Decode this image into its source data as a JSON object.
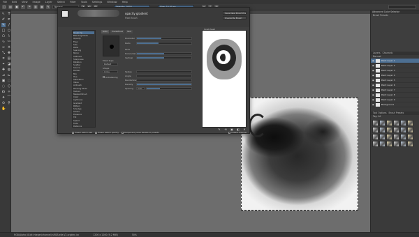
{
  "menu": [
    "File",
    "Edit",
    "View",
    "Image",
    "Layer",
    "Select",
    "Filter",
    "Tools",
    "Settings",
    "Window",
    "Help"
  ],
  "toolbar": {
    "blend_mode": "Normal",
    "preset_field": "opacity gradient",
    "opacity_slider": "Opacity: 100%",
    "size_slider": "Size: 10.00 px"
  },
  "document": {
    "tab_title": "[Not Saved] *",
    "close_glyph": "×"
  },
  "statusbar": {
    "color_info": "RGB/Alpha (8-bit integer/channel) sRGB-elle-V2-srgbtrc.icc",
    "size_info": "1200 x 1200 (9.2 MiB)",
    "zoom": "50%"
  },
  "dialog": {
    "preset_name": "opacity gradient",
    "preset_sub": "Pixel Brush",
    "buttons": {
      "save_new": "Save New Brush Preset...",
      "overwrite": "Overwrite Brush"
    },
    "options": [
      "Brush Tip",
      "Blending Mode",
      "Opacity",
      "Flow",
      "Size",
      "Ratio",
      "Spacing",
      "Mirror",
      "Softness",
      "Sharpness",
      "Rotation",
      "Scatter",
      "Source",
      "Darken",
      "Mix",
      "Hue",
      "Saturation",
      "Value",
      "Airbrush",
      "Painting Mode",
      "Texture",
      "Masked Brush",
      "Color",
      "Lightness",
      "Gradient",
      "Pattern",
      "Smudge",
      "Stroke",
      "Pressure",
      "Tilt",
      "Speed",
      "Fade",
      "Distance",
      "Time",
      "Fuzzy"
    ],
    "tabs": [
      "Auto",
      "Predefined",
      "Text"
    ],
    "params": {
      "diameter_label": "Diameter",
      "diameter_value": "10.00 px",
      "ratio_label": "Ratio",
      "ratio_value": "1.00",
      "fade_label": "Fade",
      "horizontal_label": "Horizontal",
      "horizontal_value": "0.50",
      "vertical_label": "Vertical",
      "vertical_value": "0.50",
      "mask_type_label": "Mask Type",
      "mask_type_value": "Default",
      "shape_label": "Shape",
      "shape_value": "Circle",
      "antialias_label": "Antialiasing",
      "spikes_label": "Spikes",
      "spikes_value": "2",
      "angle_label": "Angle",
      "angle_value": "0°",
      "randomness_label": "Randomness",
      "randomness_value": "0.00",
      "density_label": "Density",
      "density_value": "100.00%",
      "spacing_label": "Spacing",
      "spacing_value": "0.10",
      "auto_label": "Auto"
    },
    "scratchpad_label": "Scratchpad",
    "footer": {
      "eraser_size": "Eraser switch size",
      "eraser_opacity": "Eraser switch opacity",
      "temp_save": "Temporarily save tweaks to presets",
      "instant_preview": "Instant Preview"
    }
  },
  "dockers": {
    "advanced_color": "Advanced Color Selector",
    "overview_sub": "Brush Presets",
    "layers_tabs": [
      "Layers",
      "Channels"
    ],
    "layers_filter": "Normal",
    "layers": [
      "Paint Layer 1",
      "Paint Layer 2",
      "Paint Layer 3",
      "Paint Layer 4",
      "Paint Layer 5",
      "Paint Layer 6",
      "Paint Layer 7",
      "Paint Layer 8",
      "Paint Layer 9",
      "Background"
    ],
    "presets_tabs": [
      "Tool Options",
      "Brush Presets"
    ],
    "presets_filter": "Tag: All"
  },
  "colors": {
    "accent": "#4d6f92",
    "bg": "#5f5f5f",
    "canvas_bg": "#6d6d6d"
  }
}
